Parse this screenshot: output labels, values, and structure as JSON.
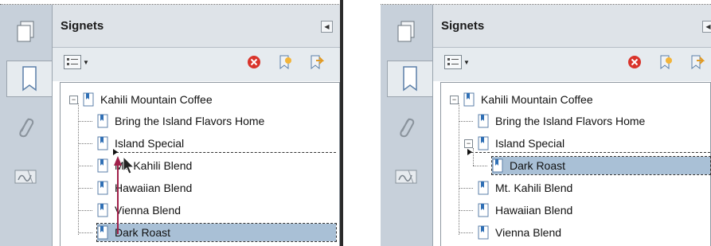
{
  "panel_title": "Signets",
  "left": {
    "root": "Kahili Mountain Coffee",
    "items": [
      "Bring the Island Flavors Home",
      "Island Special",
      "Mt. Kahili Blend",
      "Hawaiian Blend",
      "Vienna Blend",
      "Dark Roast"
    ]
  },
  "right": {
    "root": "Kahili Mountain Coffee",
    "items": [
      "Bring the Island Flavors Home",
      "Island Special",
      "Dark Roast",
      "Mt. Kahili Blend",
      "Hawaiian Blend",
      "Vienna Blend"
    ]
  },
  "icons": {
    "pages": "pages-icon",
    "bookmarks": "bookmark-panel-icon",
    "attachments": "paperclip-icon",
    "signatures": "signature-icon",
    "options": "options-menu-icon",
    "delete": "delete-icon",
    "new_bookmark": "new-bookmark-icon",
    "expand": "expand-bookmark-icon"
  },
  "colors": {
    "sidebar": "#c7d0da",
    "header": "#dee3e8",
    "selection": "#a9c0d6",
    "delete_red": "#d9342b",
    "drag_arrow": "#a0204a"
  }
}
